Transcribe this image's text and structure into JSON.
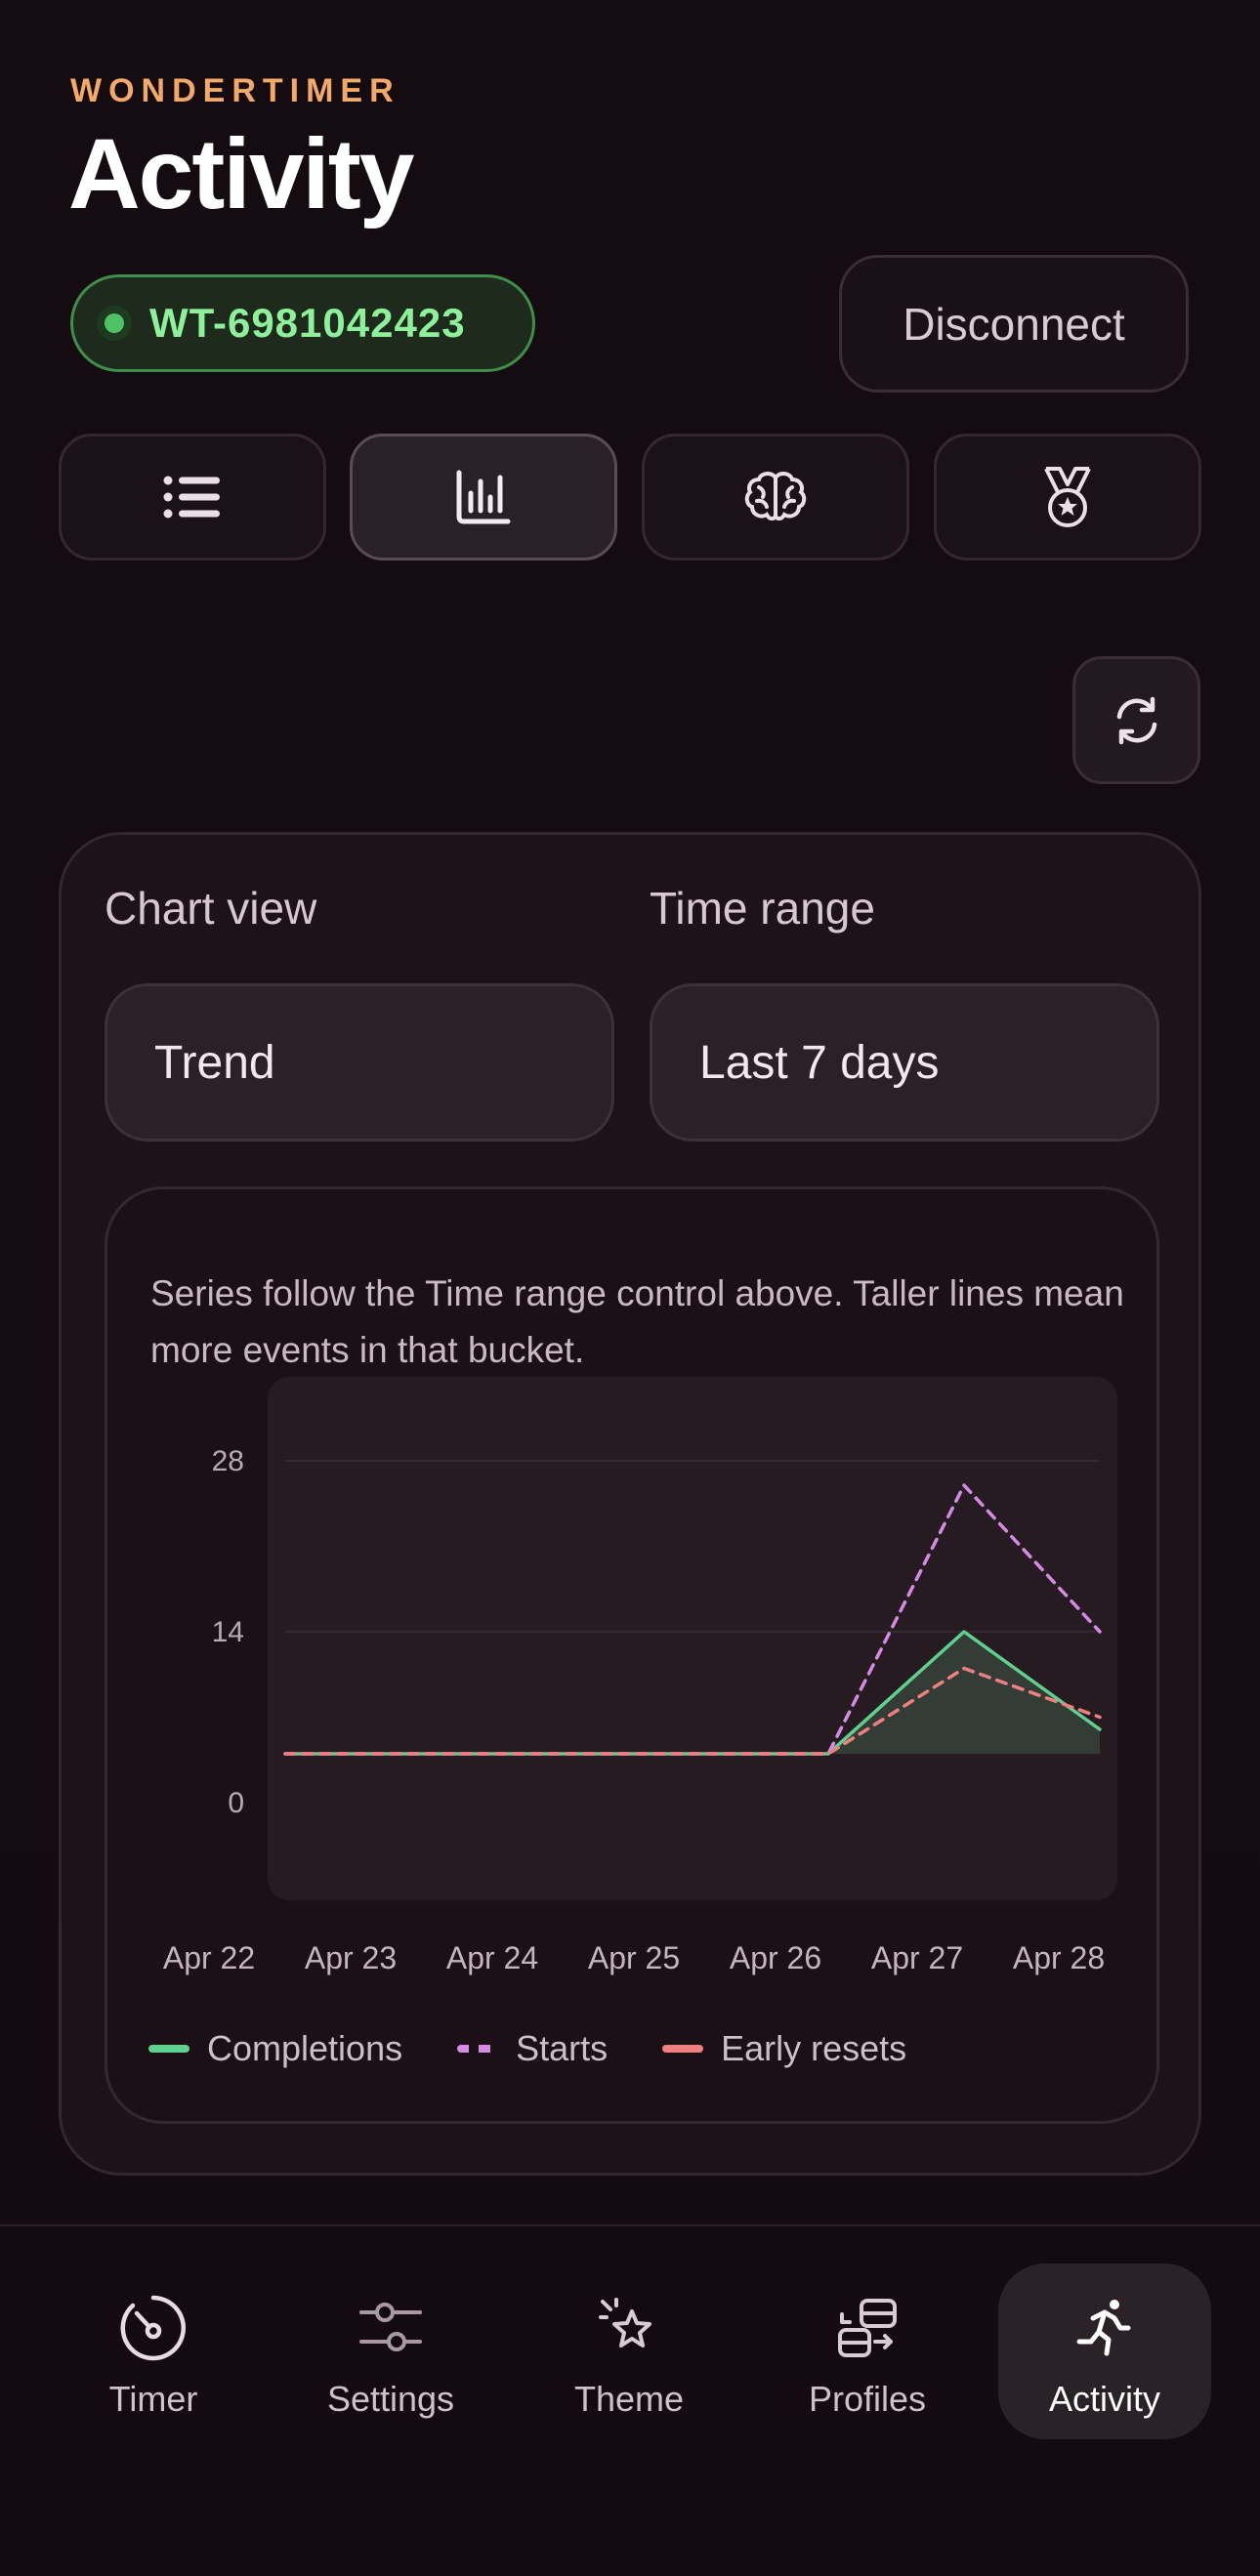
{
  "header": {
    "brand": "WONDERTIMER",
    "title": "Activity",
    "device_id": "WT-6981042423",
    "disconnect_label": "Disconnect"
  },
  "view_tabs": [
    {
      "icon": "list-icon",
      "active": false
    },
    {
      "icon": "bar-chart-icon",
      "active": true
    },
    {
      "icon": "brain-icon",
      "active": false
    },
    {
      "icon": "medal-icon",
      "active": false
    }
  ],
  "refresh_icon": "refresh-icon",
  "controls": {
    "chart_view_label": "Chart view",
    "chart_view_value": "Trend",
    "time_range_label": "Time range",
    "time_range_value": "Last 7 days"
  },
  "chart_description": "Series follow the Time range control above. Taller lines mean more events in that bucket.",
  "chart_data": {
    "type": "line",
    "categories": [
      "Apr 22",
      "Apr 23",
      "Apr 24",
      "Apr 25",
      "Apr 26",
      "Apr 27",
      "Apr 28"
    ],
    "y_ticks": [
      0,
      14,
      28
    ],
    "ylim": [
      0,
      28
    ],
    "grid": true,
    "legend": "bottom",
    "series": [
      {
        "name": "Completions",
        "values": [
          4,
          4,
          4,
          4,
          4,
          14,
          6
        ],
        "color": "#5fd08e",
        "style": "solid",
        "filled": true
      },
      {
        "name": "Starts",
        "values": [
          4,
          4,
          4,
          4,
          4,
          26,
          14
        ],
        "color": "#d58ae6",
        "style": "dashed"
      },
      {
        "name": "Early resets",
        "values": [
          4,
          4,
          4,
          4,
          4,
          11,
          7
        ],
        "color": "#f07f7f",
        "style": "dashed"
      }
    ]
  },
  "bottom_nav": [
    {
      "label": "Timer",
      "icon": "timer-icon",
      "active": false
    },
    {
      "label": "Settings",
      "icon": "sliders-icon",
      "active": false
    },
    {
      "label": "Theme",
      "icon": "sparkle-star-icon",
      "active": false
    },
    {
      "label": "Profiles",
      "icon": "profiles-icon",
      "active": false
    },
    {
      "label": "Activity",
      "icon": "runner-icon",
      "active": true
    }
  ]
}
